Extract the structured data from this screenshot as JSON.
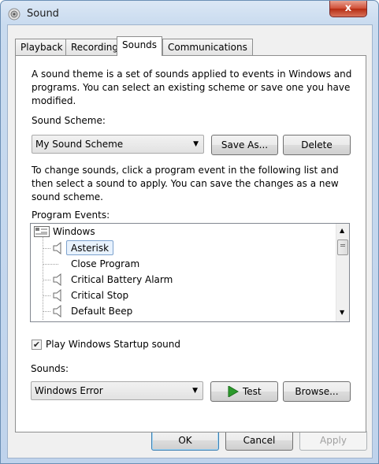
{
  "window": {
    "title": "Sound",
    "close_glyph": "x"
  },
  "tabs": [
    {
      "label": "Playback",
      "active": false
    },
    {
      "label": "Recording",
      "active": false
    },
    {
      "label": "Sounds",
      "active": true
    },
    {
      "label": "Communications",
      "active": false
    }
  ],
  "sounds_tab": {
    "description": "A sound theme is a set of sounds applied to events in Windows and programs.  You can select an existing scheme or save one you have modified.",
    "scheme_label": "Sound Scheme:",
    "scheme_value": "My Sound Scheme",
    "save_as_label": "Save As...",
    "delete_label": "Delete",
    "change_instructions": "To change sounds, click a program event in the following list and then select a sound to apply.  You can save the changes as a new sound scheme.",
    "program_events_label": "Program Events:",
    "events": {
      "root": "Windows",
      "items": [
        {
          "label": "Asterisk",
          "has_sound": true,
          "selected": true
        },
        {
          "label": "Close Program",
          "has_sound": false,
          "selected": false
        },
        {
          "label": "Critical Battery Alarm",
          "has_sound": true,
          "selected": false
        },
        {
          "label": "Critical Stop",
          "has_sound": true,
          "selected": false
        },
        {
          "label": "Default Beep",
          "has_sound": true,
          "selected": false
        }
      ]
    },
    "startup_checkbox_label": "Play Windows Startup sound",
    "startup_checked": true,
    "sounds_label": "Sounds:",
    "sound_value": "Windows Error",
    "test_label": "Test",
    "browse_label": "Browse..."
  },
  "footer": {
    "ok_label": "OK",
    "cancel_label": "Cancel",
    "apply_label": "Apply"
  },
  "colors": {
    "selection_border": "#7da2ce",
    "selection_fill": "#e8f2fd",
    "play_green": "#2c9a2c"
  }
}
